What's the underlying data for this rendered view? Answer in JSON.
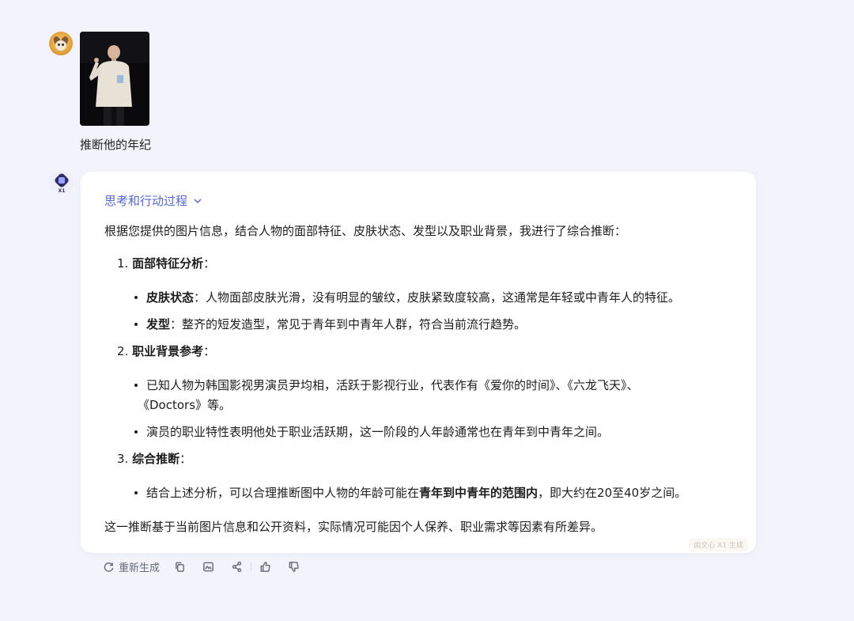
{
  "user_message": {
    "avatar_icon": "fox-avatar-icon",
    "image_description_icon": "photo-thumbnail",
    "text": "推断他的年纪"
  },
  "assistant": {
    "avatar_label": "X1",
    "thinking_label": "思考和行动过程",
    "intro": "根据您提供的图片信息，结合人物的面部特征、皮肤状态、发型以及职业背景，我进行了综合推断：",
    "sections": [
      {
        "number": "1.",
        "title": "面部特征分析",
        "suffix": "：",
        "bullets": [
          {
            "bold": "皮肤状态",
            "text": "：人物面部皮肤光滑，没有明显的皱纹，皮肤紧致度较高，这通常是年轻或中青年人的特征。"
          },
          {
            "bold": "发型",
            "text": "：整齐的短发造型，常见于青年到中青年人群，符合当前流行趋势。"
          }
        ]
      },
      {
        "number": "2.",
        "title": "职业背景参考",
        "suffix": "：",
        "bullets": [
          {
            "text_line1": "已知人物为韩国影视男演员尹均相，活跃于影视行业，代表作有《爱你的时间》、《六龙飞天》、",
            "text_line2": "《Doctors》等。"
          },
          {
            "text": "演员的职业特性表明他处于职业活跃期，这一阶段的人年龄通常也在青年到中青年之间。"
          }
        ]
      },
      {
        "number": "3.",
        "title": "综合推断",
        "suffix": "：",
        "bullets": [
          {
            "pre": "结合上述分析，可以合理推断图中人物的年龄可能在",
            "bold": "青年到中青年的范围内",
            "post": "，即大约在20至40岁之间。"
          }
        ]
      }
    ],
    "outro": "这一推断基于当前图片信息和公开资料，实际情况可能因个人保养、职业需求等因素有所差异。",
    "watermark": "由文心 X1 生成"
  },
  "actions": {
    "regenerate_label": "重新生成",
    "icons": [
      "refresh-icon",
      "copy-icon",
      "image-icon",
      "share-icon",
      "thumbs-up-icon",
      "thumbs-down-icon"
    ]
  },
  "colors": {
    "background": "#f3f4fb",
    "card": "#ffffff",
    "accent": "#5568d9"
  }
}
